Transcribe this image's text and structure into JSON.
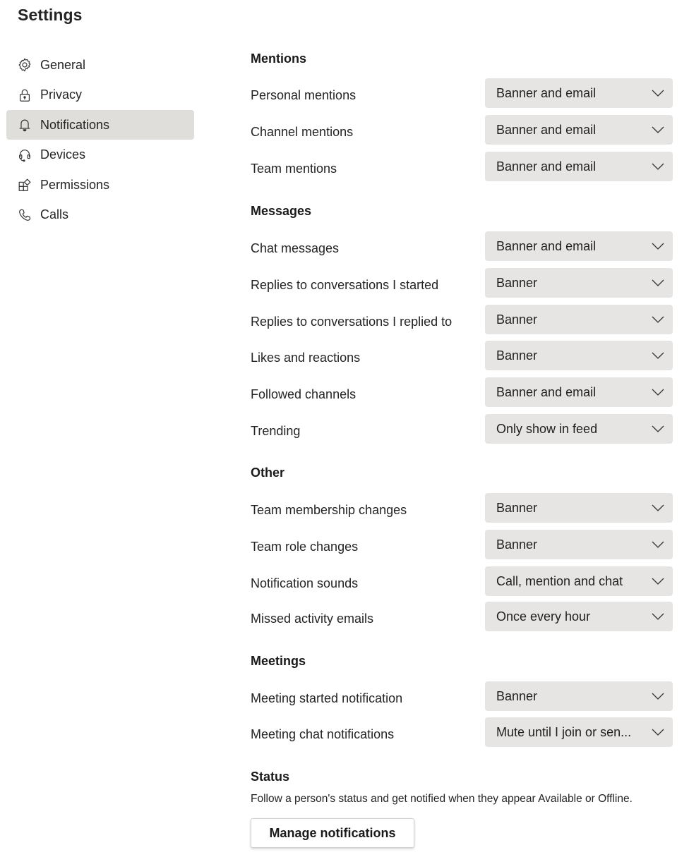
{
  "page": {
    "title": "Settings"
  },
  "sidebar": {
    "items": [
      {
        "label": "General",
        "icon": "gear-icon",
        "active": false
      },
      {
        "label": "Privacy",
        "icon": "lock-icon",
        "active": false
      },
      {
        "label": "Notifications",
        "icon": "bell-icon",
        "active": true
      },
      {
        "label": "Devices",
        "icon": "headset-icon",
        "active": false
      },
      {
        "label": "Permissions",
        "icon": "apps-icon",
        "active": false
      },
      {
        "label": "Calls",
        "icon": "phone-icon",
        "active": false
      }
    ]
  },
  "sections": {
    "mentions": {
      "heading": "Mentions",
      "rows": [
        {
          "label": "Personal mentions",
          "value": "Banner and email"
        },
        {
          "label": "Channel mentions",
          "value": "Banner and email"
        },
        {
          "label": "Team mentions",
          "value": "Banner and email"
        }
      ]
    },
    "messages": {
      "heading": "Messages",
      "rows": [
        {
          "label": "Chat messages",
          "value": "Banner and email"
        },
        {
          "label": "Replies to conversations I started",
          "value": "Banner"
        },
        {
          "label": "Replies to conversations I replied to",
          "value": "Banner"
        },
        {
          "label": "Likes and reactions",
          "value": "Banner"
        },
        {
          "label": "Followed channels",
          "value": "Banner and email"
        },
        {
          "label": "Trending",
          "value": "Only show in feed"
        }
      ]
    },
    "other": {
      "heading": "Other",
      "rows": [
        {
          "label": "Team membership changes",
          "value": "Banner"
        },
        {
          "label": "Team role changes",
          "value": "Banner"
        },
        {
          "label": "Notification sounds",
          "value": "Call, mention and chat"
        },
        {
          "label": "Missed activity emails",
          "value": "Once every hour"
        }
      ]
    },
    "meetings": {
      "heading": "Meetings",
      "rows": [
        {
          "label": "Meeting started notification",
          "value": "Banner"
        },
        {
          "label": "Meeting chat notifications",
          "value": "Mute until I join or sen..."
        }
      ]
    },
    "status": {
      "heading": "Status",
      "description": "Follow a person's status and get notified when they appear Available or Offline.",
      "button_label": "Manage notifications"
    }
  }
}
